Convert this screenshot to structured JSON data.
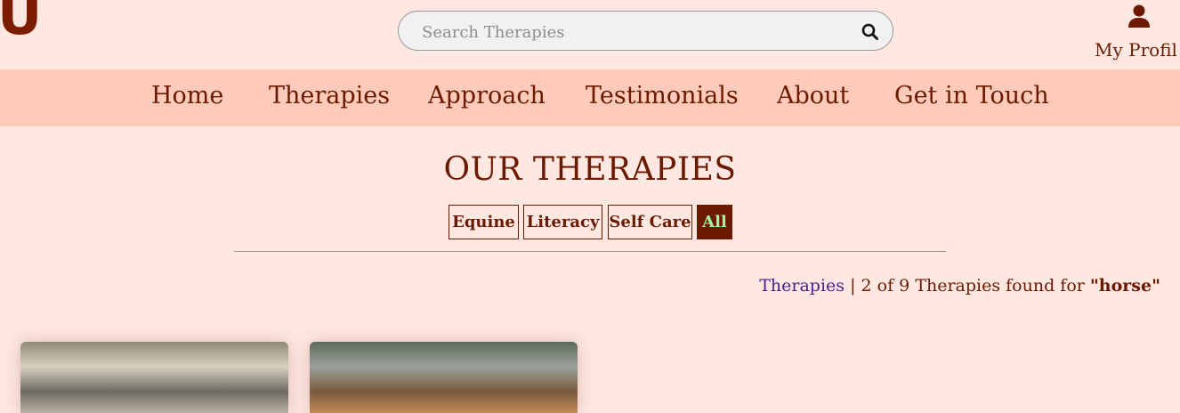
{
  "header": {
    "logo_text": "U",
    "search": {
      "placeholder": "Search Therapies",
      "value": ""
    },
    "profile_label": "My Profil"
  },
  "nav": {
    "items": [
      "Home",
      "Therapies",
      "Approach",
      "Testimonials",
      "About",
      "Get in Touch"
    ]
  },
  "main": {
    "title": "OUR THERAPIES",
    "filters": [
      {
        "label": "Equine",
        "active": false
      },
      {
        "label": "Literacy",
        "active": false
      },
      {
        "label": "Self Care",
        "active": false
      },
      {
        "label": "All",
        "active": true
      }
    ],
    "results": {
      "link": "Therapies",
      "separator": "|",
      "text": "2 of 9 Therapies found for",
      "query": "\"horse\""
    },
    "cards": [
      {
        "image": "indoor-arena-photo"
      },
      {
        "image": "horse-rider-photo"
      }
    ]
  },
  "colors": {
    "background": "#ffe8e1",
    "nav_background": "#fecbbb",
    "brand_text": "#6b1a00",
    "active_filter_text": "#a8f0a0",
    "link": "#4a1f8a"
  }
}
